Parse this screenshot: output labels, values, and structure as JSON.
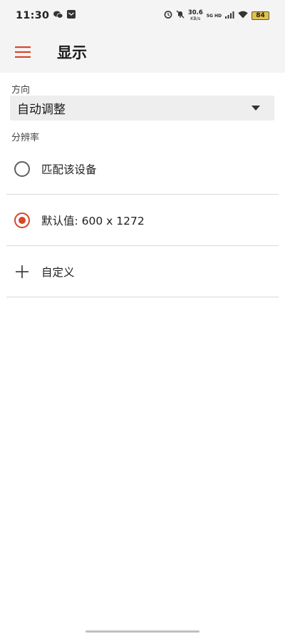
{
  "status_bar": {
    "time": "11:30",
    "net_speed": "30.6",
    "net_unit": "KB/s",
    "signal_label": "5G HD",
    "battery": "84",
    "icons": [
      "wechat-icon",
      "mail-icon",
      "alarm-icon",
      "mute-icon",
      "signal-icon",
      "wifi-icon",
      "battery-icon"
    ]
  },
  "app_bar": {
    "title": "显示",
    "menu_icon": "hamburger-menu-icon"
  },
  "orientation": {
    "label": "方向",
    "selected": "自动调整"
  },
  "resolution": {
    "label": "分辨率",
    "options": [
      {
        "label": "匹配该设备",
        "checked": false,
        "icon": "radio-icon"
      },
      {
        "label": "默认值: 600 x 1272",
        "checked": true,
        "icon": "radio-icon"
      },
      {
        "label": "自定义",
        "icon": "plus-icon"
      }
    ]
  },
  "colors": {
    "accent": "#d4482a",
    "app_bar_bg": "#f4f4f4",
    "divider": "#d8d8d8"
  }
}
